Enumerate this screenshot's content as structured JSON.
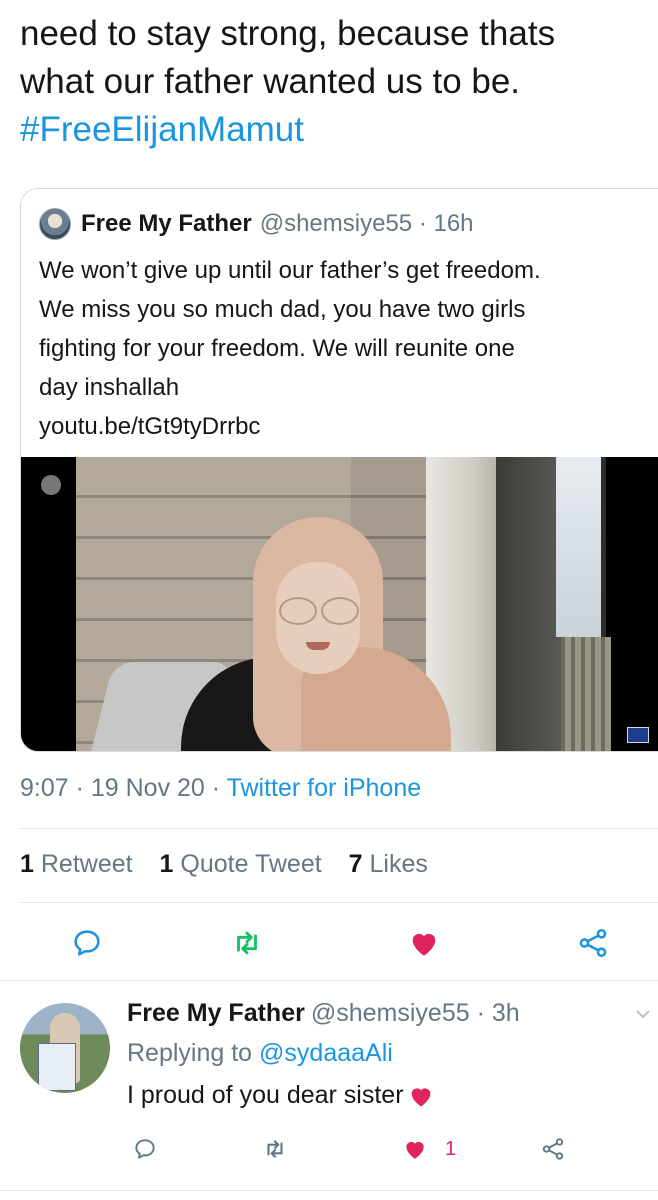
{
  "tweet": {
    "text_lines": [
      "need to stay strong, because thats",
      "what our father wanted us to be."
    ],
    "hashtag": "#FreeElijanMamut"
  },
  "quoted_tweet": {
    "name": "Free My Father",
    "handle": "@shemsiye55 · 16h",
    "lines": [
      "We won’t give up until our father’s get freedom.",
      "We miss you so much dad, you have two girls",
      "fighting for your freedom. We will reunite one",
      "day inshallah",
      "youtu.be/tGt9tyDrrbc"
    ]
  },
  "meta": {
    "time_date": "9:07 · 19 Nov 20 · ",
    "source": "Twitter for iPhone"
  },
  "stats": {
    "retweets_count": "1",
    "retweets_label": "Retweet",
    "quotes_count": "1",
    "quotes_label": "Quote Tweet",
    "likes_count": "7",
    "likes_label": "Likes"
  },
  "reply": {
    "name": "Free My Father",
    "handle": "@shemsiye55 · 3h",
    "replying_prefix": "Replying to ",
    "replying_to": "@sydaaaAli",
    "text": "I proud of you dear sister",
    "like_count": "1"
  },
  "colors": {
    "link": "#1b95e0",
    "retweet": "#17bf63",
    "like": "#e0245e",
    "muted": "#657786"
  },
  "icons": [
    "reply-icon",
    "retweet-icon",
    "heart-icon",
    "share-icon",
    "chevron-down-icon",
    "heart-emoji"
  ]
}
